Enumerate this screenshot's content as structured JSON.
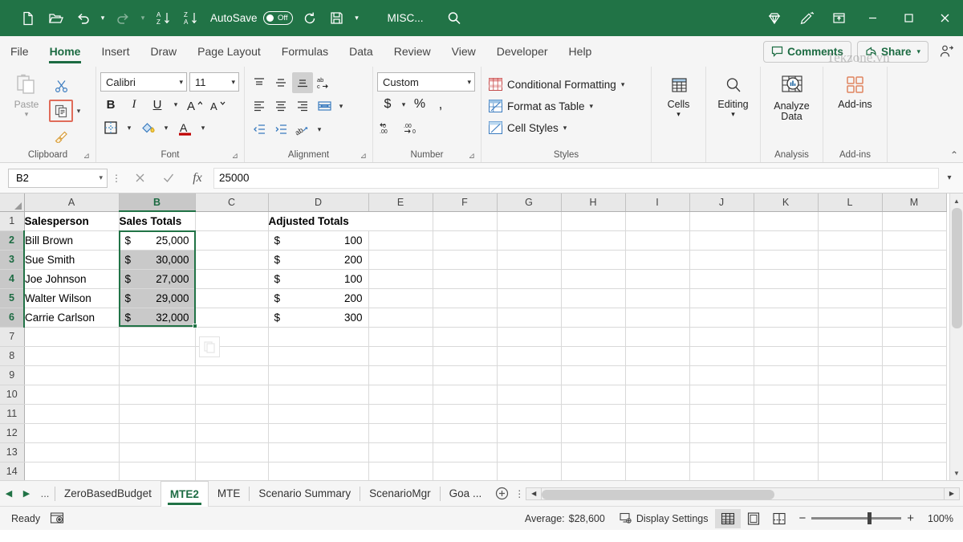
{
  "titlebar": {
    "quick_access": [
      {
        "name": "new-file-icon",
        "label": "New"
      },
      {
        "name": "open-folder-icon",
        "label": "Open"
      },
      {
        "name": "undo-icon",
        "label": "Undo"
      },
      {
        "name": "redo-icon",
        "label": "Redo"
      },
      {
        "name": "sort-az-icon",
        "label": "Sort Ascending"
      },
      {
        "name": "sort-za-icon",
        "label": "Sort Descending"
      }
    ],
    "autosave_label": "AutoSave",
    "autosave_state": "Off",
    "refresh_label": "Refresh",
    "save_label": "Save",
    "customize_label": "Customize Quick Access Toolbar",
    "document_title": "MISC...",
    "search_label": "Search",
    "copilot_label": "Copilot",
    "draw_label": "Draw",
    "ribbon_display_label": "Ribbon Display Options",
    "minimize_label": "Minimize",
    "maximize_label": "Maximize",
    "close_label": "Close",
    "bg_color": "#217346"
  },
  "ribbon_tabs": {
    "tabs": [
      {
        "label": "File",
        "active": false
      },
      {
        "label": "Home",
        "active": true
      },
      {
        "label": "Insert",
        "active": false
      },
      {
        "label": "Draw",
        "active": false
      },
      {
        "label": "Page Layout",
        "active": false
      },
      {
        "label": "Formulas",
        "active": false
      },
      {
        "label": "Data",
        "active": false
      },
      {
        "label": "Review",
        "active": false
      },
      {
        "label": "View",
        "active": false
      },
      {
        "label": "Developer",
        "active": false
      },
      {
        "label": "Help",
        "active": false
      }
    ],
    "comments_label": "Comments",
    "share_label": "Share",
    "accent_color": "#1c6b42"
  },
  "ribbon": {
    "clipboard": {
      "group_label": "Clipboard",
      "paste_label": "Paste",
      "cut_label": "Cut",
      "copy_label": "Copy",
      "format_painter_label": "Format Painter",
      "copy_highlighted": true,
      "highlight_color": "#e06c5a"
    },
    "font": {
      "group_label": "Font",
      "font_name": "Calibri",
      "font_size": "11",
      "bold_label": "B",
      "italic_label": "I",
      "underline_label": "U",
      "grow_font_label": "Increase Font Size",
      "shrink_font_label": "Decrease Font Size",
      "borders_label": "Borders",
      "fill_color_label": "Fill Color",
      "font_color_label": "Font Color",
      "font_color": "#c00000"
    },
    "alignment": {
      "group_label": "Alignment",
      "top_align_label": "Top Align",
      "middle_align_label": "Middle Align",
      "bottom_align_label": "Bottom Align",
      "wrap_text_label": "Wrap Text",
      "align_left_label": "Align Left",
      "align_center_label": "Center",
      "align_right_label": "Align Right",
      "merge_center_label": "Merge & Center",
      "decrease_indent_label": "Decrease Indent",
      "increase_indent_label": "Increase Indent",
      "orientation_label": "Orientation"
    },
    "number": {
      "group_label": "Number",
      "format": "Custom",
      "accounting_label": "Accounting Number Format",
      "percent_label": "Percent Style",
      "comma_label": "Comma Style",
      "increase_decimal_label": "Increase Decimal",
      "decrease_decimal_label": "Decrease Decimal"
    },
    "styles": {
      "group_label": "Styles",
      "items": [
        {
          "label": "Conditional Formatting",
          "icon": "conditional-formatting-icon"
        },
        {
          "label": "Format as Table",
          "icon": "format-as-table-icon"
        },
        {
          "label": "Cell Styles",
          "icon": "cell-styles-icon"
        }
      ]
    },
    "cells": {
      "group_label": "",
      "label": "Cells"
    },
    "editing": {
      "group_label": "",
      "label": "Editing"
    },
    "analysis": {
      "group_label": "Analysis",
      "label": "Analyze Data"
    },
    "addins": {
      "group_label": "Add-ins",
      "label": "Add-ins"
    }
  },
  "formula_bar": {
    "name_box": "B2",
    "cancel_label": "Cancel",
    "enter_label": "Enter",
    "function_label": "Insert Function",
    "value": "25000",
    "expand_label": "Expand Formula Bar"
  },
  "grid": {
    "columns": [
      "A",
      "B",
      "C",
      "D",
      "E",
      "F",
      "G",
      "H",
      "I",
      "J",
      "K",
      "L",
      "M"
    ],
    "selected_column": "B",
    "rows": [
      1,
      2,
      3,
      4,
      5,
      6,
      7,
      8,
      9,
      10,
      11,
      12,
      13,
      14
    ],
    "selected_rows": [
      2,
      3,
      4,
      5,
      6
    ],
    "selection_range": "B2:B6",
    "active_cell": "B2",
    "data": [
      {
        "row": 1,
        "A": "Salesperson",
        "B": "Sales Totals",
        "C": "",
        "D": "Adjusted Totals",
        "bold": true
      },
      {
        "row": 2,
        "A": "Bill Brown",
        "B_cur": "$",
        "B_val": "25,000",
        "C": "",
        "D_cur": "$",
        "D_val": "100"
      },
      {
        "row": 3,
        "A": "Sue Smith",
        "B_cur": "$",
        "B_val": "30,000",
        "C": "",
        "D_cur": "$",
        "D_val": "200"
      },
      {
        "row": 4,
        "A": "Joe Johnson",
        "B_cur": "$",
        "B_val": "27,000",
        "C": "",
        "D_cur": "$",
        "D_val": "100"
      },
      {
        "row": 5,
        "A": "Walter Wilson",
        "B_cur": "$",
        "B_val": "29,000",
        "C": "",
        "D_cur": "$",
        "D_val": "200"
      },
      {
        "row": 6,
        "A": "Carrie Carlson",
        "B_cur": "$",
        "B_val": "32,000",
        "C": "",
        "D_cur": "$",
        "D_val": "300"
      }
    ],
    "paste_options_label": "Paste Options",
    "selection_color": "#217346"
  },
  "sheet_tabs": {
    "prev_label": "Previous Sheet",
    "next_label": "Next Sheet",
    "more_label": "...",
    "tabs": [
      {
        "label": "ZeroBasedBudget",
        "active": false
      },
      {
        "label": "MTE2",
        "active": true
      },
      {
        "label": "MTE",
        "active": false
      },
      {
        "label": "Scenario Summary",
        "active": false
      },
      {
        "label": "ScenarioMgr",
        "active": false
      },
      {
        "label": "Goa ...",
        "active": false
      }
    ],
    "add_sheet_label": "New sheet",
    "tab_menu_label": "All Sheets"
  },
  "status_bar": {
    "mode": "Ready",
    "accessibility_label": "Accessibility Checker",
    "average_label": "Average:",
    "average_value": "$28,600",
    "display_settings_label": "Display Settings",
    "normal_view_label": "Normal",
    "page_layout_label": "Page Layout",
    "page_break_label": "Page Break Preview",
    "zoom_out_label": "Zoom Out",
    "zoom_in_label": "Zoom In",
    "zoom_level": "100%"
  },
  "watermark": {
    "text": "Tekzone.vn"
  }
}
